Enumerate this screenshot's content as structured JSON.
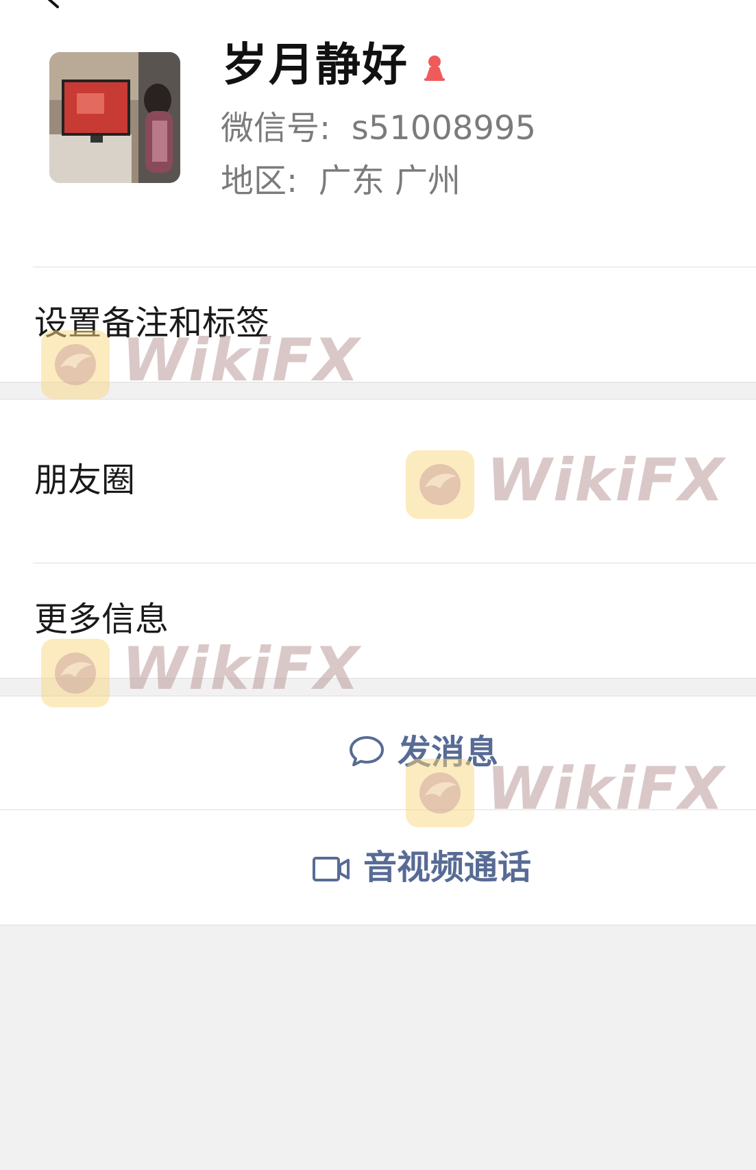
{
  "profile": {
    "name": "岁月静好",
    "wechat_id": "微信号:  s51008995",
    "region": "地区:  广东 广州"
  },
  "menu": {
    "remark_tags": "设置备注和标签",
    "moments": "朋友圈",
    "more_info": "更多信息"
  },
  "actions": {
    "send_message": "发消息",
    "video_call": "音视频通话"
  },
  "watermark": {
    "text": "WikiFX"
  },
  "colors": {
    "link_blue": "#576b95",
    "female_icon": "#f05a5a",
    "background": "#f1f1f1"
  },
  "icons": {
    "back": "chevron-left-icon",
    "gender": "female-icon",
    "message": "chat-bubble-icon",
    "video": "video-camera-icon",
    "watermark_logo": "wikifx-eagle-logo"
  }
}
